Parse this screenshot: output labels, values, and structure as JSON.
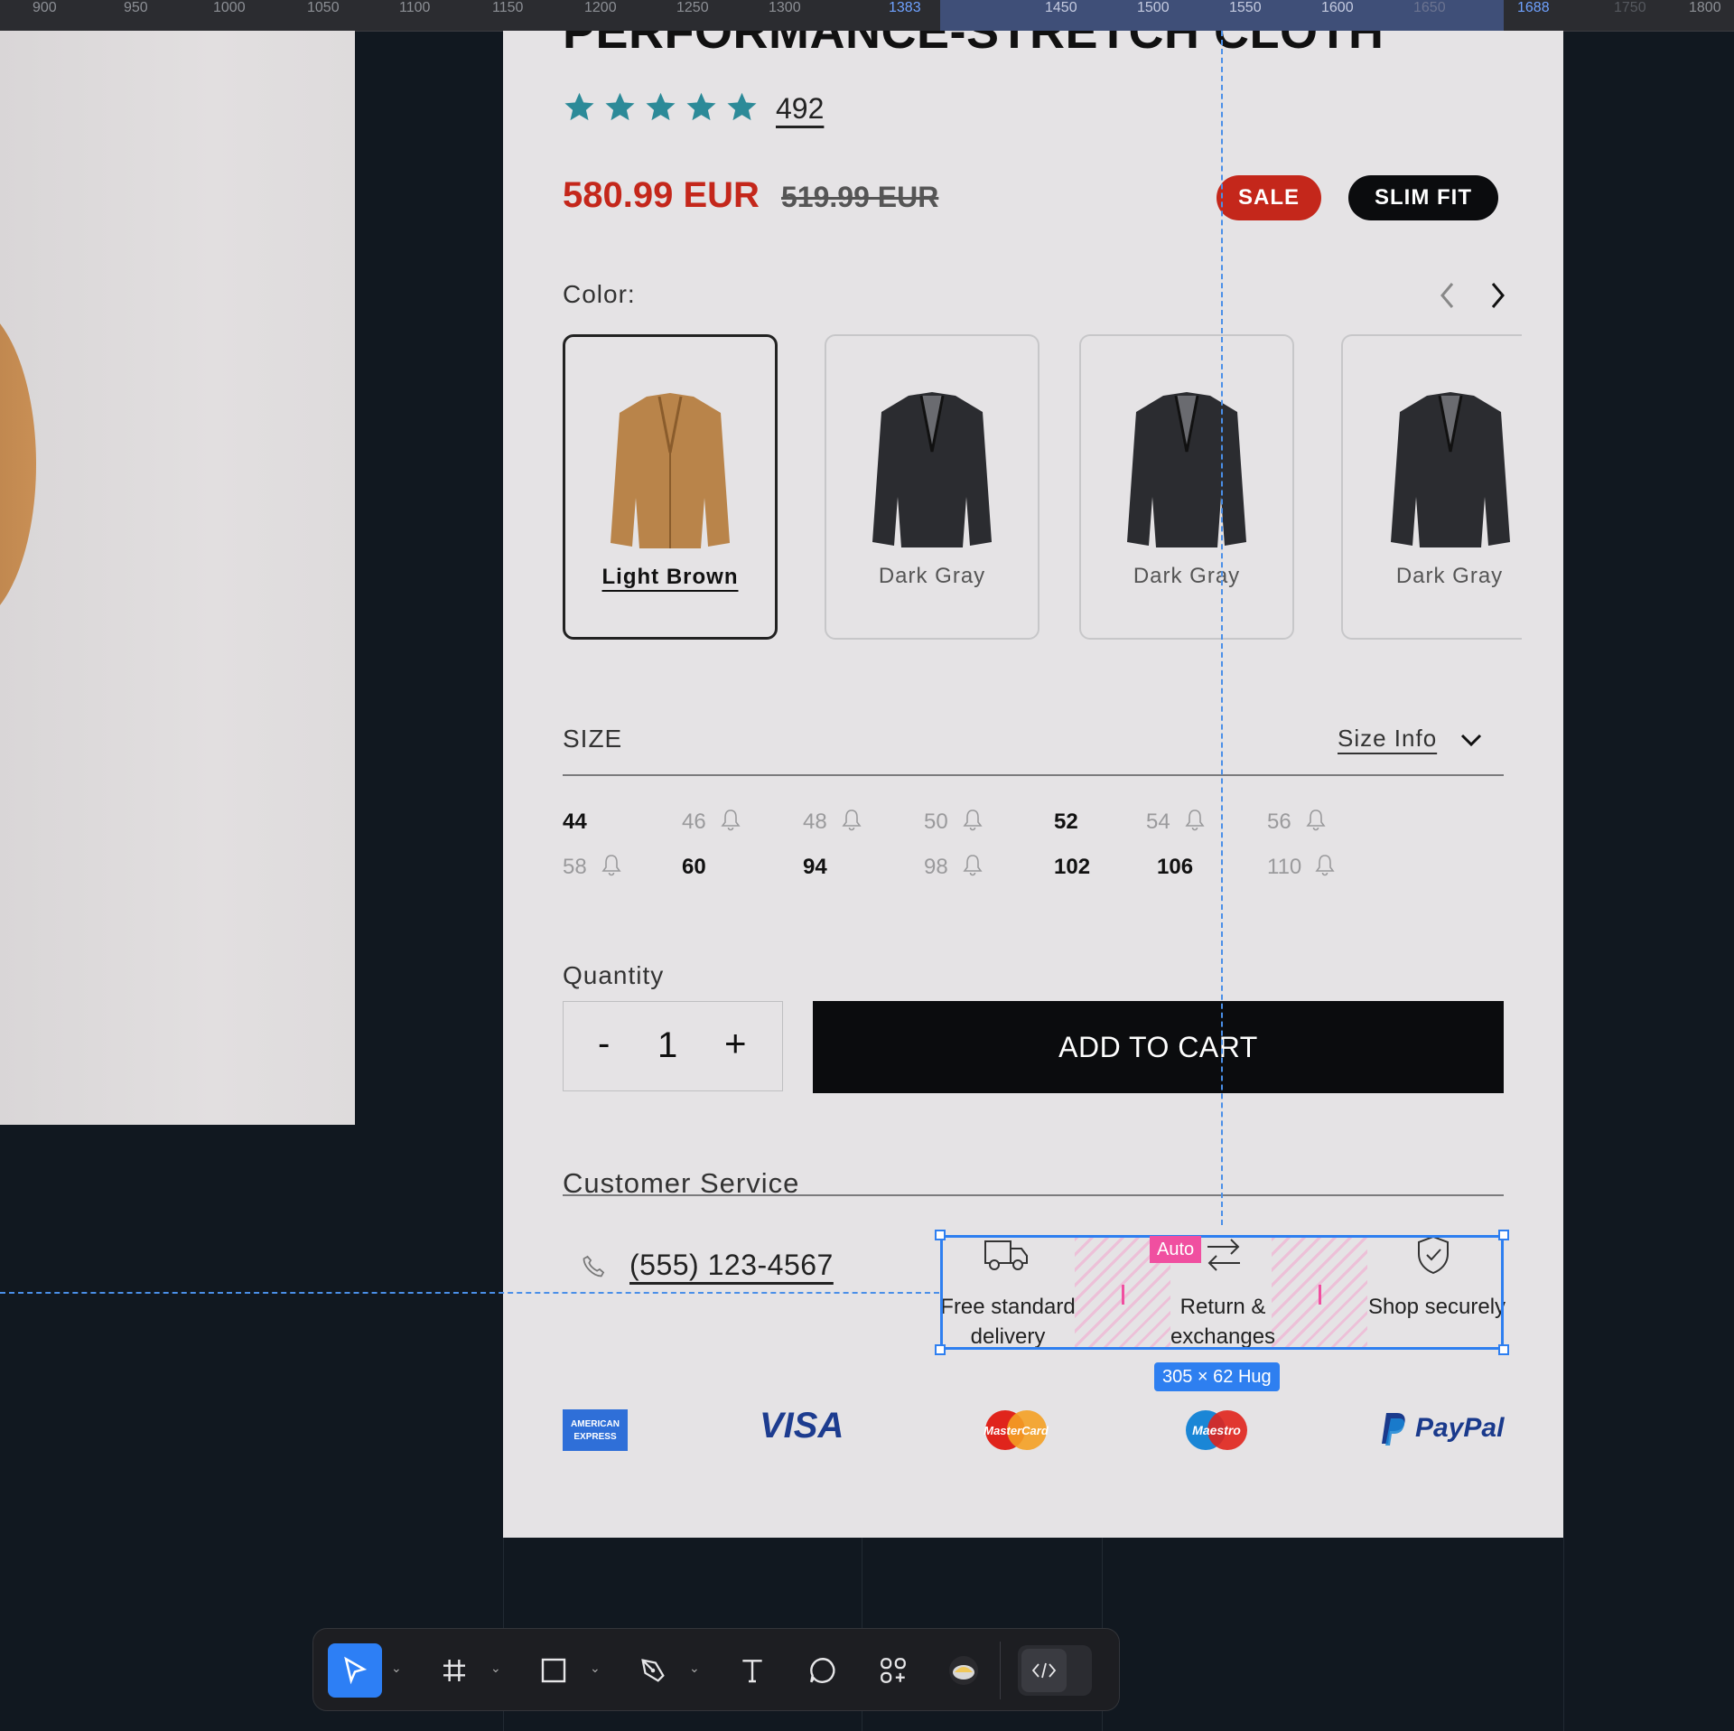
{
  "ruler": {
    "ticks": [
      "900",
      "950",
      "1000",
      "1050",
      "1100",
      "1150",
      "1200",
      "1250",
      "1300",
      "1383",
      "1450",
      "1500",
      "1550",
      "1600",
      "1650",
      "1688",
      "1750",
      "1800"
    ],
    "selection_start": "1383",
    "selection_end": "1688"
  },
  "product": {
    "title": "PERFORMANCE-STRETCH CLOTH",
    "rating": 5,
    "review_count": "492",
    "price": "580.99 EUR",
    "old_price": "519.99 EUR",
    "badges": {
      "sale": "SALE",
      "fit": "SLIM FIT"
    },
    "colors": {
      "sale_red": "#c4271b",
      "star_teal": "#2c8a98",
      "button_black": "#0b0c0e"
    }
  },
  "color_section": {
    "label": "Color:",
    "prev_icon": "chevron-left-icon",
    "next_icon": "chevron-right-icon",
    "swatches": [
      {
        "label": "Light Brown",
        "selected": true,
        "color": "#b9844a"
      },
      {
        "label": "Dark Gray",
        "selected": false,
        "color": "#2b2c30"
      },
      {
        "label": "Dark Gray",
        "selected": false,
        "color": "#2b2c30"
      },
      {
        "label": "Dark Gray",
        "selected": false,
        "color": "#2b2c30"
      }
    ]
  },
  "size_section": {
    "label": "SIZE",
    "size_info": "Size Info",
    "rows": [
      [
        {
          "size": "44",
          "available": true
        },
        {
          "size": "46",
          "available": false
        },
        {
          "size": "48",
          "available": false
        },
        {
          "size": "50",
          "available": false
        },
        {
          "size": "52",
          "available": true
        },
        {
          "size": "54",
          "available": false
        },
        {
          "size": "56",
          "available": false
        }
      ],
      [
        {
          "size": "58",
          "available": false
        },
        {
          "size": "60",
          "available": true
        },
        {
          "size": "94",
          "available": true
        },
        {
          "size": "98",
          "available": false
        },
        {
          "size": "102",
          "available": true
        },
        {
          "size": "106",
          "available": true
        },
        {
          "size": "110",
          "available": false
        }
      ]
    ]
  },
  "quantity": {
    "label": "Quantity",
    "minus": "-",
    "value": "1",
    "plus": "+"
  },
  "cart": {
    "label": "ADD TO CART"
  },
  "customer_service": {
    "label": "Customer Service",
    "phone": "(555) 123-4567",
    "items": [
      {
        "icon": "truck-icon",
        "label": "Free standard delivery"
      },
      {
        "icon": "return-arrows-icon",
        "label": "Return & exchanges"
      },
      {
        "icon": "shield-check-icon",
        "label": "Shop securely"
      }
    ]
  },
  "payments": [
    "AMERICAN EXPRESS",
    "VISA",
    "MasterCard",
    "Maestro",
    "PayPal"
  ],
  "editor": {
    "auto_tag": "Auto",
    "size_tag": "305 × 62 Hug",
    "selection_color": "#2e7ff0",
    "tools": [
      "move-tool",
      "frame-tool",
      "rectangle-tool",
      "pen-tool",
      "text-tool",
      "comment-tool",
      "components-tool",
      "plugin-tool",
      "dev-mode-toggle"
    ]
  }
}
